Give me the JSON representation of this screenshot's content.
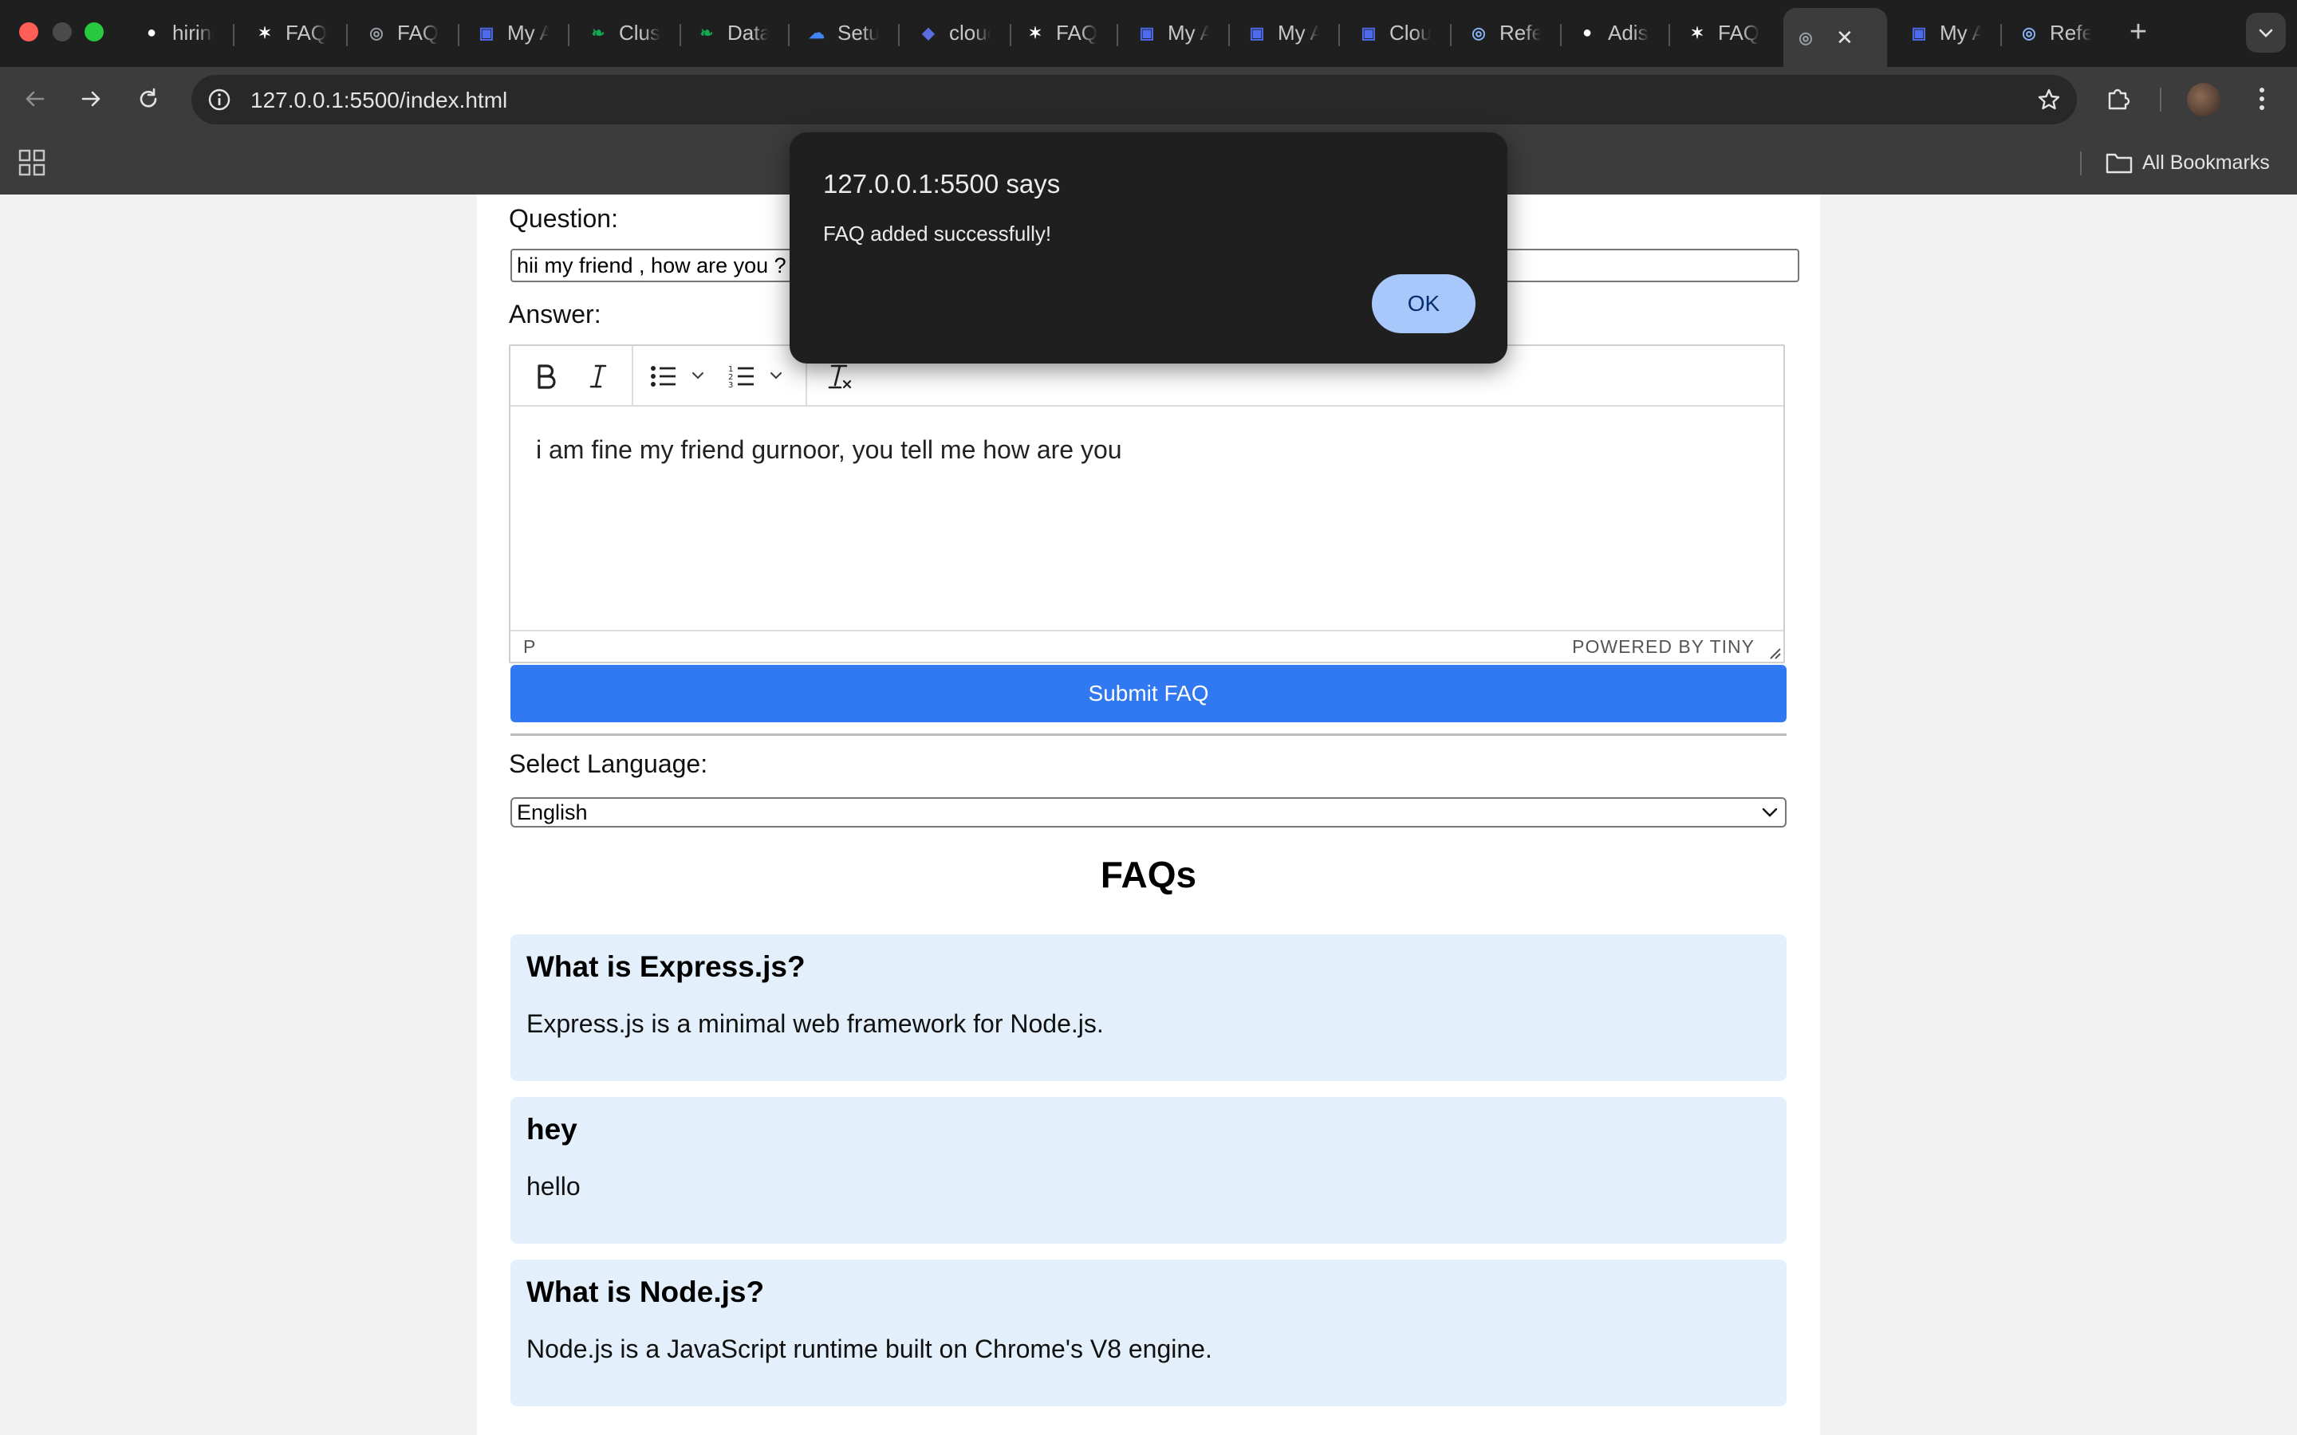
{
  "browser": {
    "tabs": [
      {
        "title": "hiring",
        "favicon": "github-icon",
        "color": "#ffffff",
        "active": false
      },
      {
        "title": "FAQ",
        "favicon": "openai-icon",
        "color": "#ffffff",
        "active": false
      },
      {
        "title": "FAQ",
        "favicon": "globe-icon",
        "color": "#9aa0a6",
        "active": false
      },
      {
        "title": "My App",
        "favicon": "app-icon",
        "color": "#4f6bed",
        "active": false
      },
      {
        "title": "Cluster",
        "favicon": "mongodb-leaf-icon",
        "color": "#13aa52",
        "active": false
      },
      {
        "title": "Data",
        "favicon": "mongodb-leaf-icon",
        "color": "#13aa52",
        "active": false
      },
      {
        "title": "Setup",
        "favicon": "google-cloud-icon",
        "color": "#4285f4",
        "active": false
      },
      {
        "title": "cloud",
        "favicon": "shield-icon",
        "color": "#5b6ee1",
        "active": false
      },
      {
        "title": "FAQ",
        "favicon": "openai-icon",
        "color": "#ffffff",
        "active": false
      },
      {
        "title": "My App",
        "favicon": "app-icon",
        "color": "#4f6bed",
        "active": false
      },
      {
        "title": "My App",
        "favicon": "app-icon",
        "color": "#4f6bed",
        "active": false
      },
      {
        "title": "Cloud",
        "favicon": "app-icon",
        "color": "#4f6bed",
        "active": false
      },
      {
        "title": "Reference",
        "favicon": "globe-blue-icon",
        "color": "#8ab4f8",
        "active": false
      },
      {
        "title": "Adiser",
        "favicon": "github-icon",
        "color": "#ffffff",
        "active": false
      },
      {
        "title": "FAQ",
        "favicon": "openai-icon",
        "color": "#ffffff",
        "active": false
      },
      {
        "title": "",
        "favicon": "globe-icon",
        "color": "#9aa0a6",
        "active": true
      },
      {
        "title": "My App",
        "favicon": "app-icon",
        "color": "#4f6bed",
        "active": false
      },
      {
        "title": "Reference",
        "favicon": "globe-blue-icon",
        "color": "#8ab4f8",
        "active": false
      }
    ],
    "url": "127.0.0.1:5500/index.html",
    "bookmarks_label": "All Bookmarks"
  },
  "form": {
    "question_label": "Question:",
    "question_value": "hii my friend , how are you ?",
    "answer_label": "Answer:",
    "editor_content": "i am fine my friend gurnoor, you tell me how are you",
    "editor_path": "P",
    "editor_brand": "POWERED BY TINY",
    "submit_label": "Submit FAQ",
    "language_label": "Select Language:",
    "language_value": "English"
  },
  "faqs": {
    "title": "FAQs",
    "items": [
      {
        "question": "What is Express.js?",
        "answer": "Express.js is a minimal web framework for Node.js."
      },
      {
        "question": "hey",
        "answer": "hello"
      },
      {
        "question": "What is Node.js?",
        "answer": "Node.js is a JavaScript runtime built on Chrome's V8 engine."
      }
    ]
  },
  "dialog": {
    "title": "127.0.0.1:5500 says",
    "message": "FAQ added successfully!",
    "ok_label": "OK"
  },
  "colors": {
    "accent": "#3179f2",
    "faq_card": "#e3f0fb",
    "dialog_bg": "#1f1f1f",
    "ok_button": "#a8c7fa"
  }
}
